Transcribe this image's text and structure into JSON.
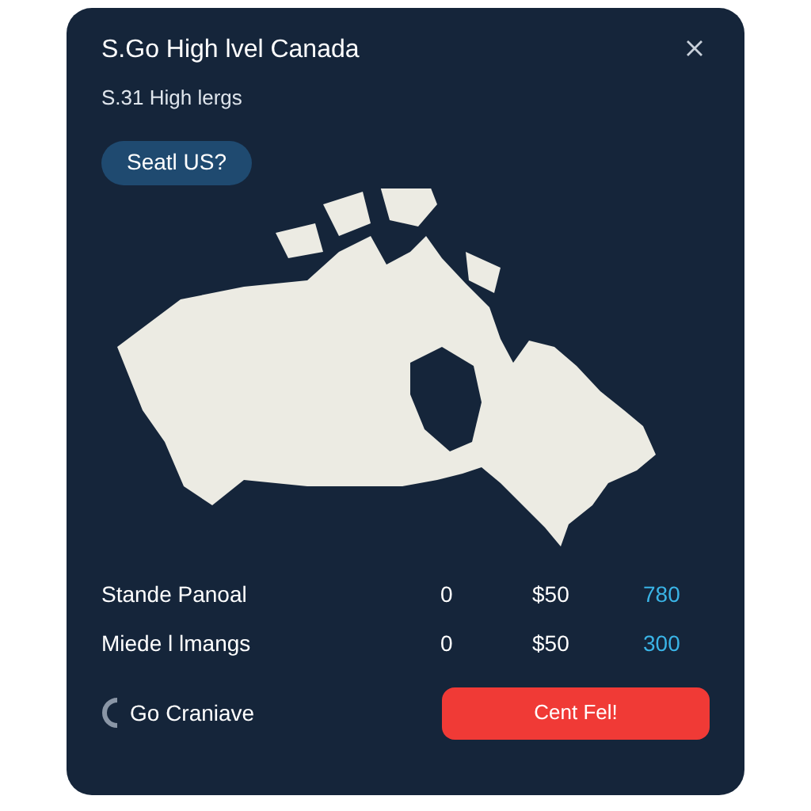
{
  "dialog": {
    "title": "S.Go High lvel Canada",
    "subtitle": "S.31 High lergs",
    "pill_button": "Seatl US?"
  },
  "rows": [
    {
      "label": "Stande Panoal",
      "col_2": "0",
      "col_3": "$50",
      "col_4": "780"
    },
    {
      "label": "Miede l lmangs",
      "col_2": "0",
      "col_3": "$50",
      "col_4": "300"
    }
  ],
  "footer": {
    "link": "Go Craniave",
    "button": "Cent Fel!"
  }
}
